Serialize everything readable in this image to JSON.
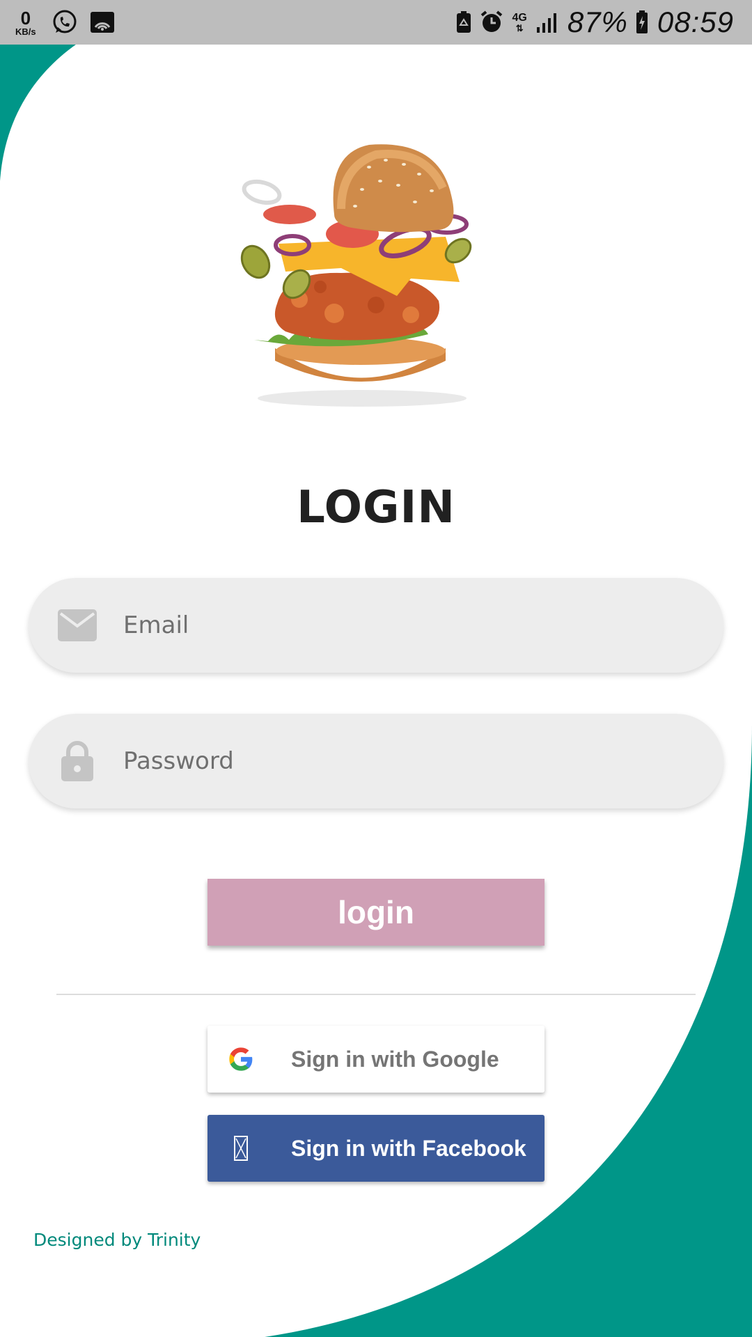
{
  "status_bar": {
    "speed_value": "0",
    "speed_unit": "KB/s",
    "network_type": "4G",
    "battery_percent": "87%",
    "time": "08:59",
    "icons": [
      "whatsapp-icon",
      "wifi-icon",
      "recycle-icon",
      "alarm-icon",
      "signal-icon",
      "battery-charging-icon"
    ]
  },
  "login": {
    "title": "LOGIN",
    "email_placeholder": "Email",
    "password_placeholder": "Password",
    "login_button": "login"
  },
  "social": {
    "google_label": "Sign in with Google",
    "facebook_label": "Sign in with Facebook"
  },
  "footer": {
    "credit": "Designed by Trinity"
  },
  "colors": {
    "accent_teal": "#009688",
    "login_button": "#d0a0b6",
    "facebook_blue": "#3b5a9a",
    "field_bg": "#ededed"
  }
}
